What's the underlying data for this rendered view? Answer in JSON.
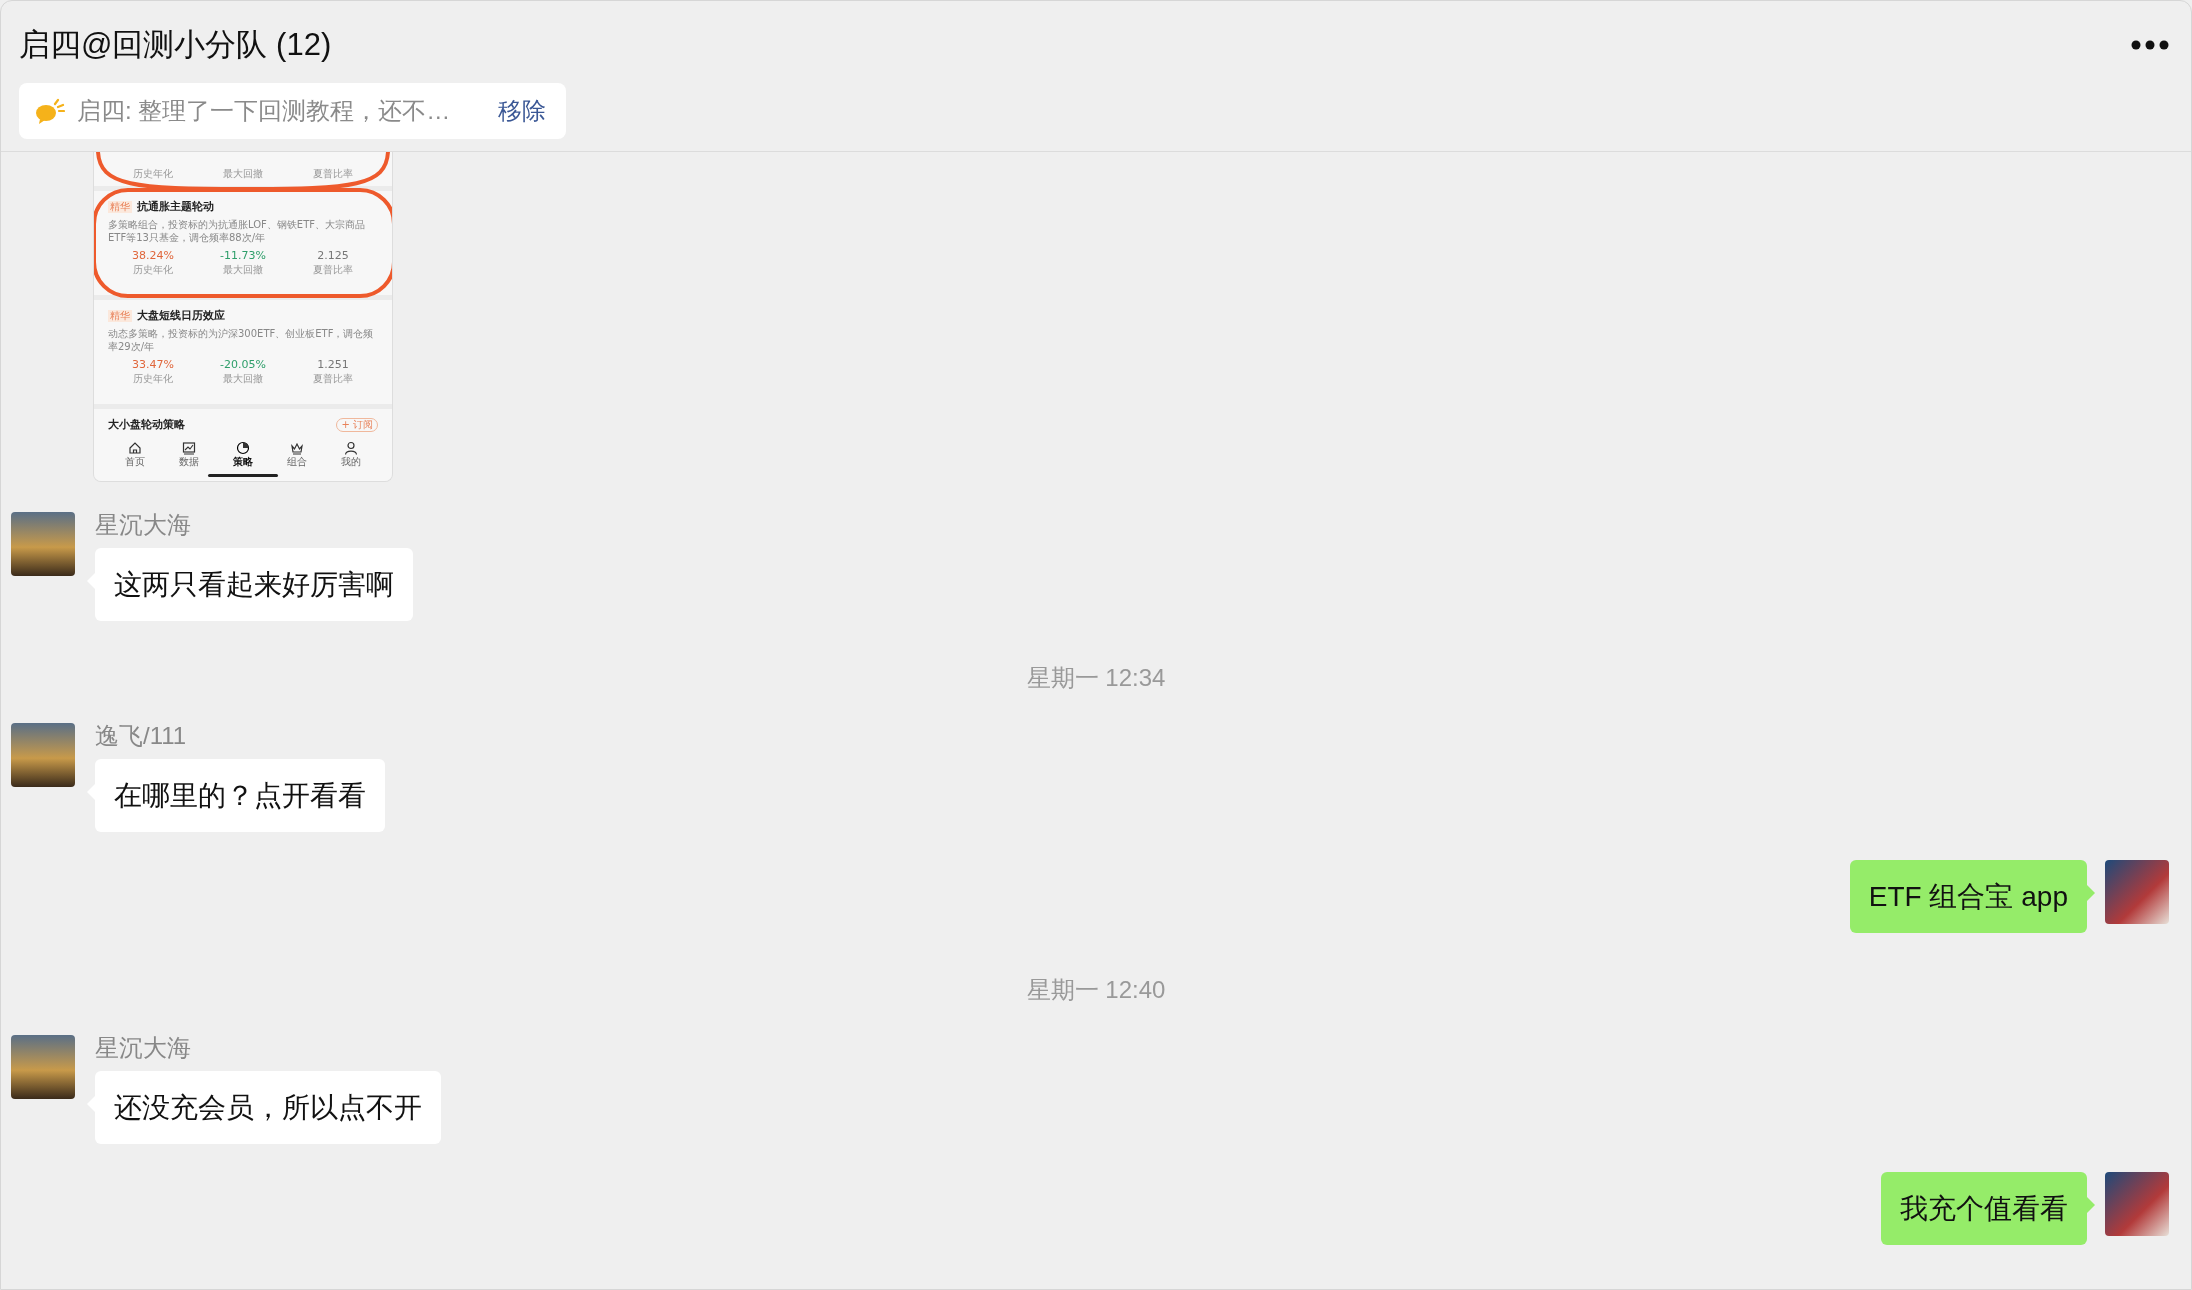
{
  "chat": {
    "title": "启四@回测小分队 (12)"
  },
  "pinned": {
    "text": "启四: 整理了一下回测教程，还不…",
    "action": "移除"
  },
  "messages": [
    {
      "kind": "image",
      "shot": {
        "cut_row": {
          "circled": true,
          "labels": [
            "历史年化",
            "最大回撤",
            "夏普比率"
          ]
        },
        "strategies": [
          {
            "tag": "精华",
            "title": "抗通胀主题轮动",
            "description": "多策略组合，投资标的为抗通胀LOF、钢铁ETF、大宗商品ETF等13只基金，调仓频率88次/年",
            "circled": true,
            "stats": [
              {
                "kind": "gain",
                "value": "38.24%",
                "label": "历史年化"
              },
              {
                "kind": "loss",
                "value": "-11.73%",
                "label": "最大回撤"
              },
              {
                "kind": "ratio",
                "value": "2.125",
                "label": "夏普比率"
              }
            ]
          },
          {
            "tag": "精华",
            "title": "大盘短线日历效应",
            "description": "动态多策略，投资标的为沪深300ETF、创业板ETF，调仓频率29次/年",
            "circled": false,
            "stats": [
              {
                "kind": "gain",
                "value": "33.47%",
                "label": "历史年化"
              },
              {
                "kind": "loss",
                "value": "-20.05%",
                "label": "最大回撤"
              },
              {
                "kind": "ratio",
                "value": "1.251",
                "label": "夏普比率"
              }
            ]
          }
        ],
        "footer": {
          "title": "大小盘轮动策略",
          "button": "+ 订阅"
        },
        "tabs": [
          {
            "label": "首页",
            "selected": false
          },
          {
            "label": "数据",
            "selected": false
          },
          {
            "label": "策略",
            "selected": true
          },
          {
            "label": "组合",
            "selected": false
          },
          {
            "label": "我的",
            "selected": false
          }
        ]
      }
    },
    {
      "kind": "received",
      "sender": "星沉大海",
      "text": "这两只看起来好厉害啊"
    },
    {
      "kind": "time",
      "text": "星期一 12:34"
    },
    {
      "kind": "received",
      "sender": "逸飞/111",
      "text": "在哪里的？点开看看"
    },
    {
      "kind": "sent",
      "text": "ETF 组合宝 app"
    },
    {
      "kind": "time",
      "text": "星期一 12:40"
    },
    {
      "kind": "received",
      "sender": "星沉大海",
      "text": "还没充会员，所以点不开"
    },
    {
      "kind": "sent",
      "text": "我充个值看看"
    }
  ]
}
